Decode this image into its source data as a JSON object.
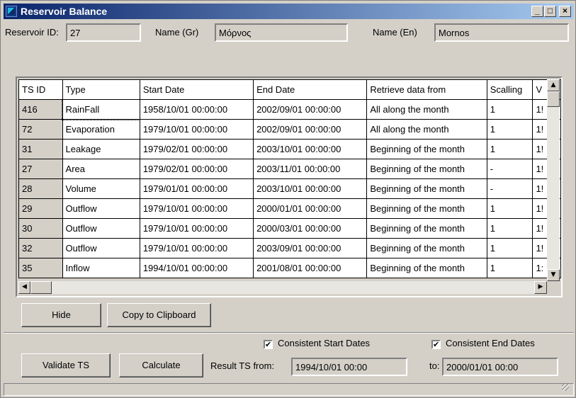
{
  "window": {
    "title": "Reservoir Balance",
    "minimize_label": "_",
    "maximize_label": "□",
    "close_label": "×"
  },
  "header": {
    "reservoir_id_label": "Reservoir ID:",
    "reservoir_id_value": "27",
    "name_gr_label": "Name (Gr)",
    "name_gr_value": "Μόρνος",
    "name_en_label": "Name (En)",
    "name_en_value": "Mornos"
  },
  "grid": {
    "columns": [
      "TS ID",
      "Type",
      "Start Date",
      "End Date",
      "Retrieve data from",
      "Scalling",
      "V"
    ],
    "rows": [
      [
        "416",
        "RainFall",
        "1958/10/01 00:00:00",
        "2002/09/01 00:00:00",
        "All along the month",
        "1",
        "1!"
      ],
      [
        "72",
        "Evaporation",
        "1979/10/01 00:00:00",
        "2002/09/01 00:00:00",
        "All along the month",
        "1",
        "1!"
      ],
      [
        "31",
        "Leakage",
        "1979/02/01 00:00:00",
        "2003/10/01 00:00:00",
        "Beginning of the month",
        "1",
        "1!"
      ],
      [
        "27",
        "Area",
        "1979/02/01 00:00:00",
        "2003/11/01 00:00:00",
        "Beginning of the month",
        "-",
        "1!"
      ],
      [
        "28",
        "Volume",
        "1979/01/01 00:00:00",
        "2003/10/01 00:00:00",
        "Beginning of the month",
        "-",
        "1!"
      ],
      [
        "29",
        "Outflow",
        "1979/10/01 00:00:00",
        "2000/01/01 00:00:00",
        "Beginning of the month",
        "1",
        "1!"
      ],
      [
        "30",
        "Outflow",
        "1979/10/01 00:00:00",
        "2000/03/01 00:00:00",
        "Beginning of the month",
        "1",
        "1!"
      ],
      [
        "32",
        "Outflow",
        "1979/10/01 00:00:00",
        "2003/09/01 00:00:00",
        "Beginning of the month",
        "1",
        "1!"
      ],
      [
        "35",
        "Inflow",
        "1994/10/01 00:00:00",
        "2001/08/01 00:00:00",
        "Beginning of the month",
        "1",
        "1:"
      ]
    ]
  },
  "buttons": {
    "hide": "Hide",
    "copy": "Copy to Clipboard",
    "validate": "Validate TS",
    "calculate": "Calculate"
  },
  "options": {
    "consistent_start": "Consistent Start Dates",
    "consistent_start_checked": true,
    "consistent_end": "Consistent End Dates",
    "consistent_end_checked": true
  },
  "result": {
    "from_label": "Result TS from:",
    "from_value": "1994/10/01 00:00",
    "to_label": "to:",
    "to_value": "2000/01/01 00:00"
  },
  "check_mark": "✔"
}
